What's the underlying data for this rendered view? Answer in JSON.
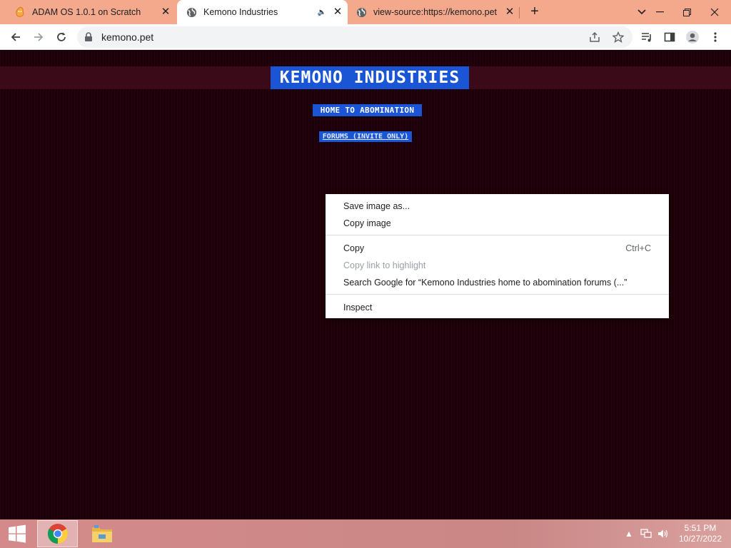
{
  "tabs": [
    {
      "title": "ADAM OS 1.0.1 on Scratch",
      "icon": "scratch-favicon-icon",
      "active": false
    },
    {
      "title": "Kemono Industries",
      "icon": "globe-icon",
      "active": true,
      "audio": true
    },
    {
      "title": "view-source:https://kemono.pet",
      "icon": "globe-icon",
      "active": false
    }
  ],
  "toolbar": {
    "url": "kemono.pet"
  },
  "page": {
    "title": "KEMONO INDUSTRIES",
    "home_line": "HOME TO ABOMINATION",
    "forums_link": "FORUMS (INVITE ONLY)",
    "background_color": "#1c0009",
    "selection_color": "#1a55d6"
  },
  "context_menu": {
    "groups": [
      [
        {
          "label": "Save image as...",
          "disabled": false
        },
        {
          "label": "Copy image",
          "disabled": false
        }
      ],
      [
        {
          "label": "Copy",
          "shortcut": "Ctrl+C",
          "disabled": false
        },
        {
          "label": "Copy link to highlight",
          "disabled": true
        },
        {
          "label": "Search Google for “Kemono Industries home to abomination forums (...”",
          "disabled": false
        }
      ],
      [
        {
          "label": "Inspect",
          "disabled": false
        }
      ]
    ]
  },
  "taskbar": {
    "apps": [
      "chrome-icon",
      "file-explorer-icon"
    ],
    "time": "5:51 PM",
    "date": "10/27/2022"
  },
  "colors": {
    "tabstrip": "#f4a88c",
    "accent_selection": "#1a55d6",
    "taskbar": "#c98786"
  }
}
